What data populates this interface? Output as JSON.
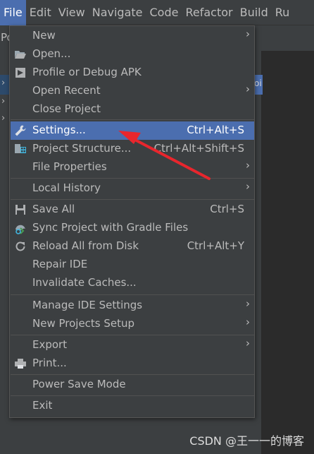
{
  "menubar": {
    "items": [
      {
        "label": "File"
      },
      {
        "label": "Edit"
      },
      {
        "label": "View"
      },
      {
        "label": "Navigate"
      },
      {
        "label": "Code"
      },
      {
        "label": "Refactor"
      },
      {
        "label": "Build"
      },
      {
        "label": "Ru"
      }
    ]
  },
  "side": {
    "project_header": "Po",
    "editor_tab": "oi"
  },
  "file_menu": {
    "new": {
      "label": "New"
    },
    "open": {
      "label": "Open..."
    },
    "profile": {
      "label": "Profile or Debug APK"
    },
    "open_recent": {
      "label": "Open Recent"
    },
    "close_project": {
      "label": "Close Project"
    },
    "settings": {
      "label": "Settings...",
      "shortcut": "Ctrl+Alt+S"
    },
    "project_structure": {
      "label": "Project Structure...",
      "shortcut": "Ctrl+Alt+Shift+S"
    },
    "file_properties": {
      "label": "File Properties"
    },
    "local_history": {
      "label": "Local History"
    },
    "save_all": {
      "label": "Save All",
      "shortcut": "Ctrl+S"
    },
    "sync_gradle": {
      "label": "Sync Project with Gradle Files"
    },
    "reload": {
      "label": "Reload All from Disk",
      "shortcut": "Ctrl+Alt+Y"
    },
    "repair": {
      "label": "Repair IDE"
    },
    "invalidate": {
      "label": "Invalidate Caches..."
    },
    "manage_settings": {
      "label": "Manage IDE Settings"
    },
    "new_projects_setup": {
      "label": "New Projects Setup"
    },
    "export": {
      "label": "Export"
    },
    "print": {
      "label": "Print..."
    },
    "power_save": {
      "label": "Power Save Mode"
    },
    "exit": {
      "label": "Exit"
    }
  },
  "watermark": "CSDN @王一一的博客",
  "colors": {
    "selection": "#4b6eaf",
    "menu_bg": "#3c3f41",
    "arrow": "#e8262d"
  }
}
